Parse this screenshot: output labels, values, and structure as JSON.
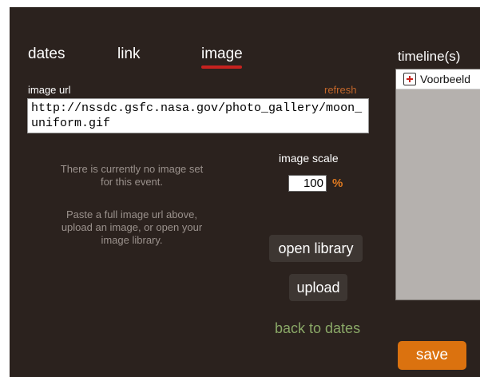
{
  "tabs": {
    "dates": "dates",
    "link": "link",
    "image": "image"
  },
  "image_url": {
    "label": "image url",
    "refresh": "refresh",
    "value": "http://nssdc.gsfc.nasa.gov/photo_gallery/moon_uniform.gif"
  },
  "info": {
    "no_image": "There is currently no image set for this event.",
    "instructions": "Paste a full image url above, upload an image, or open your image library."
  },
  "scale": {
    "label": "image scale",
    "value": "100",
    "unit": "%"
  },
  "buttons": {
    "open_library": "open library",
    "upload": "upload",
    "back_to_dates": "back to dates",
    "save": "save"
  },
  "timelines": {
    "title": "timeline(s)",
    "items": [
      {
        "label": "Voorbeeld"
      }
    ]
  },
  "colors": {
    "panel_bg": "#2b221e",
    "accent_orange": "#db720f",
    "tab_underline": "#c6221f",
    "link_green": "#8aa867"
  }
}
